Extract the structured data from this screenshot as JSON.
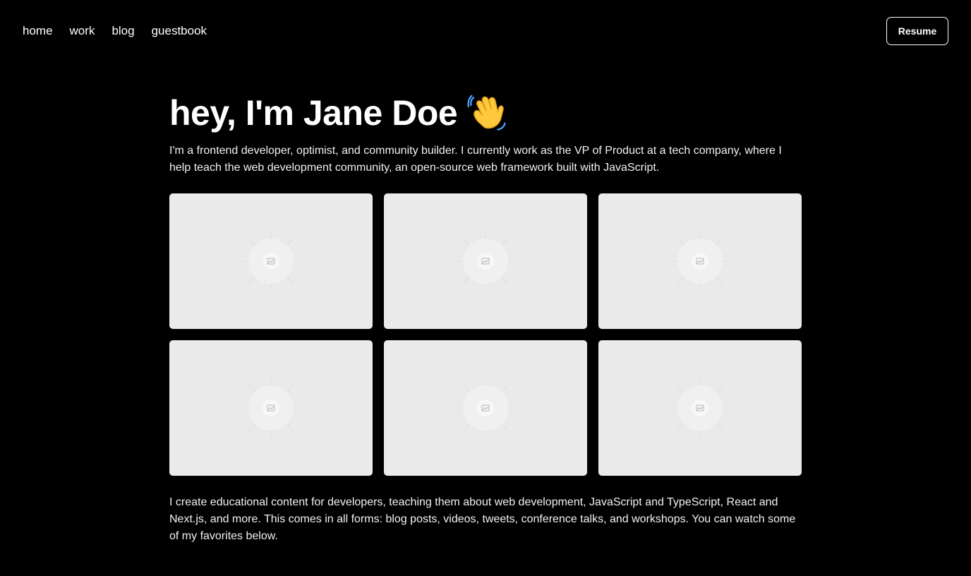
{
  "nav": {
    "links": [
      {
        "label": "home"
      },
      {
        "label": "work"
      },
      {
        "label": "blog"
      },
      {
        "label": "guestbook"
      }
    ],
    "resume_label": "Resume"
  },
  "hero": {
    "title": "hey, I'm Jane Doe",
    "title_icon": "waving-hand-icon",
    "intro": "I'm a frontend developer, optimist, and community builder. I currently work as the VP of Product at a tech company, where I help teach the web development community, an open-source web framework built with JavaScript."
  },
  "gallery": {
    "items": [
      {
        "icon": "image-placeholder-icon"
      },
      {
        "icon": "image-placeholder-icon"
      },
      {
        "icon": "image-placeholder-icon"
      },
      {
        "icon": "image-placeholder-icon"
      },
      {
        "icon": "image-placeholder-icon"
      },
      {
        "icon": "image-placeholder-icon"
      }
    ]
  },
  "outro": "I create educational content for developers, teaching them about web development, JavaScript and TypeScript, React and Next.js, and more. This comes in all forms: blog posts, videos, tweets, conference talks, and workshops. You can watch some of my favorites below.",
  "colors": {
    "background": "#000000",
    "text": "#ffffff",
    "card": "#eaeaea",
    "wave": "#ffc83d"
  }
}
